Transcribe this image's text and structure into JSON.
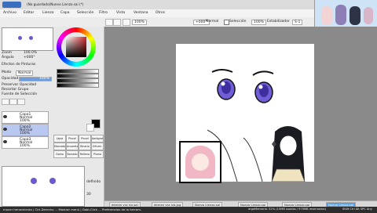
{
  "window": {
    "title": "(No guardado)Nuevo Lienzo.sai (*)"
  },
  "menu": [
    "Archivo",
    "Editar",
    "Lienzo",
    "Capa",
    "Selección",
    "Filtro",
    "Vista",
    "Ventana",
    "Otros"
  ],
  "toolbar": {
    "zoom": "100%",
    "angle": "+000°",
    "selection_label": "Selección",
    "selection_zoom": "100%",
    "mode": "Normal",
    "stabilizer_label": "Estabilizador",
    "stabilizer_value": "S-1"
  },
  "color_panel": {
    "zoom_label": "Zoom",
    "zoom_value": "100.0%",
    "angle_label": "Ángulo",
    "angle_value": "+000°",
    "effects_label": "Efectos de Pinturas",
    "hue_color": "#d62b2b"
  },
  "layer_panel": {
    "mode_label": "Modo",
    "mode_value": "Normal",
    "opacity_label": "Opacidad",
    "opacity_value": "100%",
    "checks": [
      "Preservar Opacidad",
      "Recortar Grupo",
      "Fuente de Selección"
    ],
    "layers": [
      {
        "name": "Capa1",
        "mode": "Normal",
        "opacity": "100%"
      },
      {
        "name": "Capa2",
        "mode": "Normal",
        "opacity": "100%"
      },
      {
        "name": "Capa3",
        "mode": "Normal",
        "opacity": "100%"
      }
    ]
  },
  "tools": {
    "row1": [
      "Lápiz",
      "Pincel",
      "Pincel",
      "Aerógrafo"
    ],
    "row2": [
      "Marcador",
      "Acuarela",
      "Binario",
      "Difumi."
    ],
    "row3": [
      "Goma",
      "Borrado",
      "Relleno",
      "Pluma"
    ]
  },
  "brush": {
    "size": "30",
    "size_label": "definido"
  },
  "tabs": [
    "demen vra lcx.sai",
    "demen vra lcb.jpg",
    "Nuevo Lienzo.sai",
    "Nuevo Lienzo.sai",
    "Nuevo Lienzo.sai",
    "Nuevo Lienzo.sai"
  ],
  "active_tab": 5,
  "status": {
    "hint": "mover herramienta | Ctrl-Derecho ... Mostrar menú | Dobl-Click ... Preferencias de la herram.",
    "memory": "argaMemoria: 52% (15MB usados / 970MB reservados)",
    "keys": "Shift Ctrl Alt SPC Any"
  }
}
